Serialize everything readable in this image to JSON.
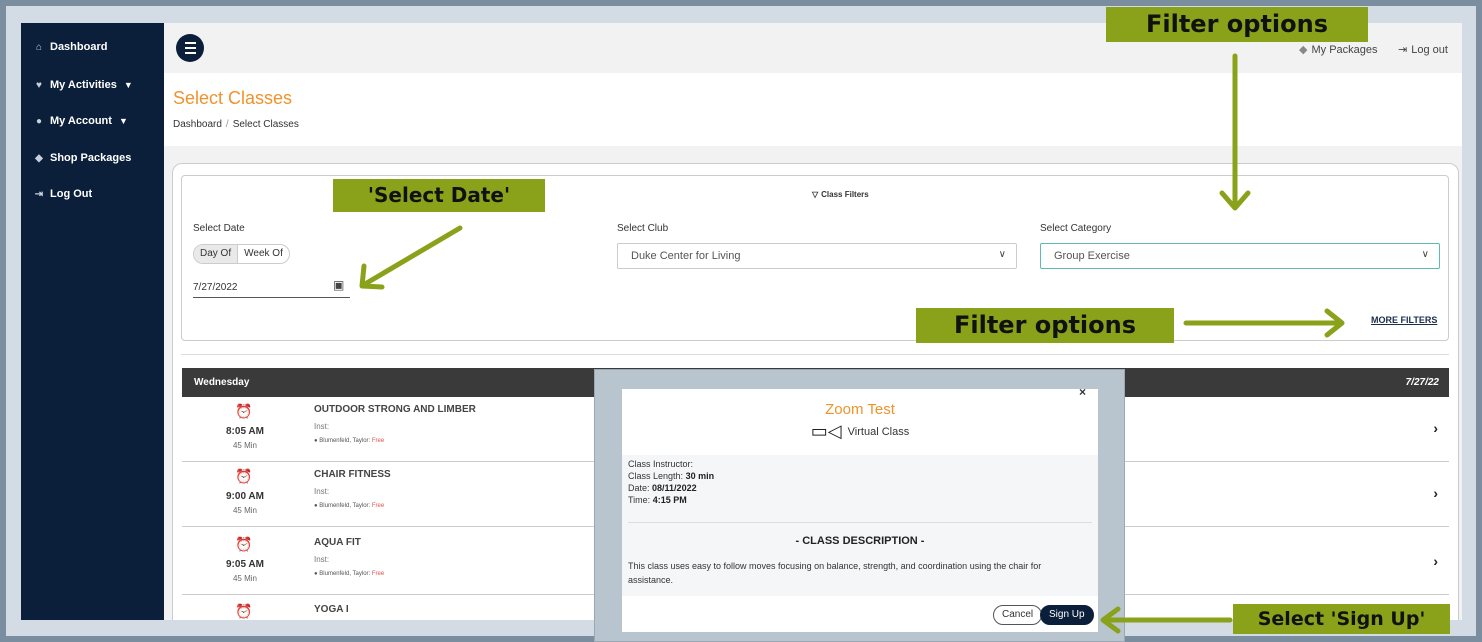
{
  "sidebar": {
    "items": [
      {
        "label": "Dashboard",
        "icon": "home-icon",
        "has_chevron": false
      },
      {
        "label": "My Activities",
        "icon": "heart-icon",
        "has_chevron": true
      },
      {
        "label": "My Account",
        "icon": "user-icon",
        "has_chevron": true
      },
      {
        "label": "Shop Packages",
        "icon": "tag-icon",
        "has_chevron": false
      },
      {
        "label": "Log Out",
        "icon": "logout-icon",
        "has_chevron": false
      }
    ]
  },
  "topbar": {
    "my_packages": "My Packages",
    "log_out": "Log out"
  },
  "header": {
    "title": "Select Classes",
    "breadcrumb": [
      "Dashboard",
      "Select Classes"
    ]
  },
  "filters": {
    "heading": "Class Filters",
    "date_label": "Select Date",
    "toggle": [
      "Day Of",
      "Week Of"
    ],
    "toggle_selected": "Day Of",
    "date_value": "7/27/2022",
    "club_label": "Select Club",
    "club_value": "Duke Center for Living",
    "category_label": "Select Category",
    "category_value": "Group Exercise",
    "more_filters": "MORE FILTERS"
  },
  "schedule": {
    "day": "Wednesday",
    "date": "7/27/22",
    "classes": [
      {
        "name": "OUTDOOR STRONG AND LIMBER",
        "time": "8:05 AM",
        "duration": "45 Min",
        "inst": "Inst:",
        "instructor": "Blumenfeld, Taylor:",
        "price": "Free"
      },
      {
        "name": "CHAIR FITNESS",
        "time": "9:00 AM",
        "duration": "45 Min",
        "inst": "Inst:",
        "instructor": "Blumenfeld, Taylor:",
        "price": "Free"
      },
      {
        "name": "AQUA FIT",
        "time": "9:05 AM",
        "duration": "45 Min",
        "inst": "Inst:",
        "instructor": "Blumenfeld, Taylor:",
        "price": "Free"
      },
      {
        "name": "YOGA I",
        "time": "",
        "duration": "",
        "inst": "",
        "instructor": "",
        "price": ""
      }
    ]
  },
  "modal": {
    "close": "×",
    "title": "Zoom Test",
    "type": "Virtual Class",
    "instructor_label": "Class Instructor:",
    "length_label": "Class Length:",
    "length_value": "30 min",
    "date_label": "Date:",
    "date_value": "08/11/2022",
    "time_label": "Time:",
    "time_value": "4:15 PM",
    "desc_heading": "- CLASS DESCRIPTION -",
    "description": "This class uses easy to follow moves focusing on balance, strength, and coordination using the chair for assistance.",
    "cancel": "Cancel",
    "sign_up": "Sign Up"
  },
  "annotations": {
    "filter_options_top": "Filter options",
    "select_date": "'Select Date'",
    "filter_options_mid": "Filter options",
    "select_sign_up": "Select 'Sign Up'",
    "accent_color": "#8aa11a"
  }
}
